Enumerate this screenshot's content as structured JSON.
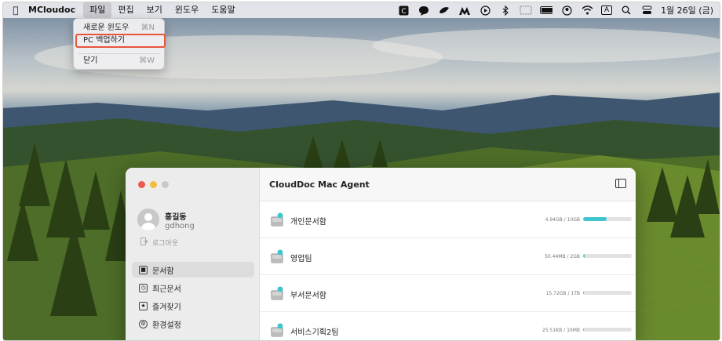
{
  "menubar": {
    "apple_icon": "apple-icon",
    "app_name": "MCloudoc",
    "menus": [
      "파일",
      "편집",
      "보기",
      "윈도우",
      "도움말"
    ],
    "clock": "1월 26일 (금)",
    "status_icons": [
      "cloudoc-icon",
      "chat-icon",
      "bird-icon",
      "malwarebytes-icon",
      "play-icon",
      "bluetooth-icon",
      "display-icon",
      "battery-icon",
      "user-icon",
      "wifi-icon",
      "input-a-icon",
      "search-icon",
      "control-center-icon"
    ],
    "input_label": "A"
  },
  "file_menu": {
    "items": [
      {
        "label": "새로운 윈도우",
        "shortcut": "⌘N"
      },
      {
        "label": "PC 백업하기",
        "shortcut": ""
      },
      {
        "label": "닫기",
        "shortcut": "⌘W"
      }
    ],
    "highlight_color": "#e8553a"
  },
  "window": {
    "title": "CloudDoc Mac Agent",
    "user": {
      "name": "홍길동",
      "id": "gdhong"
    },
    "logout": "로그아웃",
    "nav": [
      "문서함",
      "최근문서",
      "즐겨찾기",
      "환경설정"
    ],
    "folders": [
      {
        "name": "개인문서함",
        "usage": "4.94GB / 10GB",
        "fill": 0.49
      },
      {
        "name": "영업팀",
        "usage": "50.44MB / 2GB",
        "fill": 0.025
      },
      {
        "name": "부서문서함",
        "usage": "15.72GB / 1TB",
        "fill": 0.015
      },
      {
        "name": "서비스기획2팀",
        "usage": "25.51KB / 10MB",
        "fill": 0.003
      }
    ],
    "accent": "#3fc5cf"
  }
}
